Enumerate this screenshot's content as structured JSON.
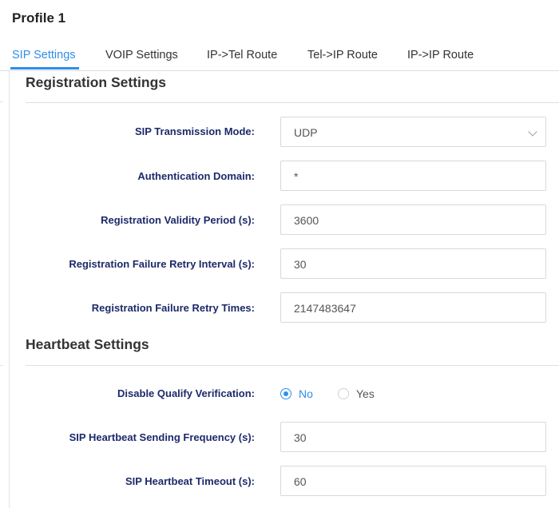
{
  "page": {
    "title": "Profile 1"
  },
  "tabs": [
    {
      "label": "SIP Settings",
      "active": true
    },
    {
      "label": "VOIP Settings",
      "active": false
    },
    {
      "label": "IP->Tel Route",
      "active": false
    },
    {
      "label": "Tel->IP Route",
      "active": false
    },
    {
      "label": "IP->IP Route",
      "active": false
    }
  ],
  "registration": {
    "heading": "Registration Settings",
    "transmission_mode": {
      "label": "SIP Transmission Mode:",
      "value": "UDP"
    },
    "auth_domain": {
      "label": "Authentication Domain:",
      "value": "*"
    },
    "validity_period": {
      "label": "Registration Validity Period (s):",
      "value": "3600"
    },
    "retry_interval": {
      "label": "Registration Failure Retry Interval (s):",
      "value": "30"
    },
    "retry_times": {
      "label": "Registration Failure Retry Times:",
      "value": "2147483647"
    }
  },
  "heartbeat": {
    "heading": "Heartbeat Settings",
    "disable_qualify": {
      "label": "Disable Qualify Verification:",
      "options": [
        "No",
        "Yes"
      ],
      "selected": "No"
    },
    "sending_frequency": {
      "label": "SIP Heartbeat Sending Frequency (s):",
      "value": "30"
    },
    "timeout": {
      "label": "SIP Heartbeat Timeout (s):",
      "value": "60"
    }
  },
  "colors": {
    "accent": "#2f8fe8",
    "label": "#1d2a6a",
    "border": "#d6d9de"
  }
}
